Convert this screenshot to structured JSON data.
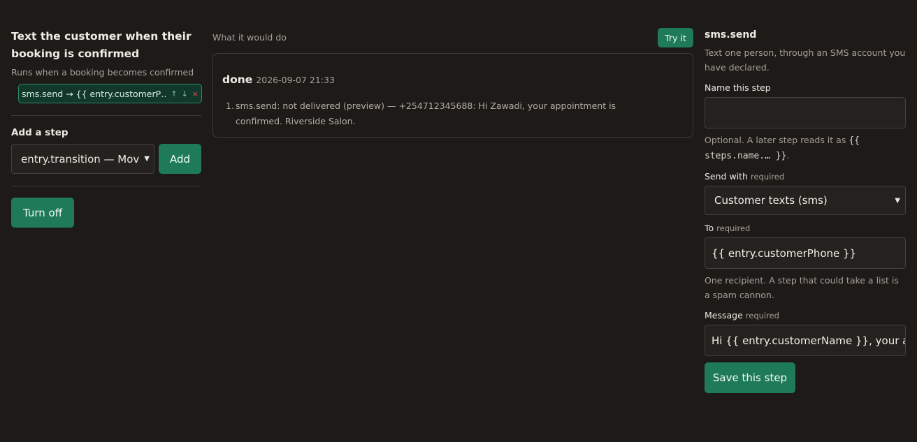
{
  "flow": {
    "title": "Text the customer when their booking is confirmed",
    "subtitle": "Runs when a booking becomes confirmed",
    "steps": [
      {
        "label": "sms.send → {{ entry.customerP…",
        "up": "↑",
        "down": "↓",
        "remove": "×"
      }
    ],
    "add_step": {
      "label": "Add a step",
      "selected": "entry.transition — Mov",
      "add_button": "Add"
    },
    "turn_off_button": "Turn off"
  },
  "preview": {
    "heading": "What it would do",
    "try_button": "Try it",
    "status": "done",
    "timestamp": "2026-09-07 21:33",
    "results": [
      {
        "num": "1.",
        "text": "sms.send: not delivered (preview) — +254712345688: Hi Zawadi, your appointment is confirmed. Riverside Salon."
      }
    ]
  },
  "editor": {
    "title": "sms.send",
    "description": "Text one person, through an SMS account you have declared.",
    "name_label": "Name this step",
    "name_value": "",
    "name_help_prefix": "Optional. A later step reads it as",
    "name_help_code": "{{ steps.name.… }}",
    "name_help_suffix": ".",
    "send_with_label": "Send with",
    "required_tag": "required",
    "send_with_value": "Customer texts (sms)",
    "to_label": "To",
    "to_value": "{{ entry.customerPhone }}",
    "to_help": "One recipient. A step that could take a list is a spam cannon.",
    "message_label": "Message",
    "message_value": "Hi {{ entry.customerName }}, your app",
    "save_button": "Save this step"
  },
  "colors": {
    "background": "#1d1a18",
    "accent": "#1f7a58",
    "chip_bg": "#12372b",
    "danger": "#e05252"
  }
}
